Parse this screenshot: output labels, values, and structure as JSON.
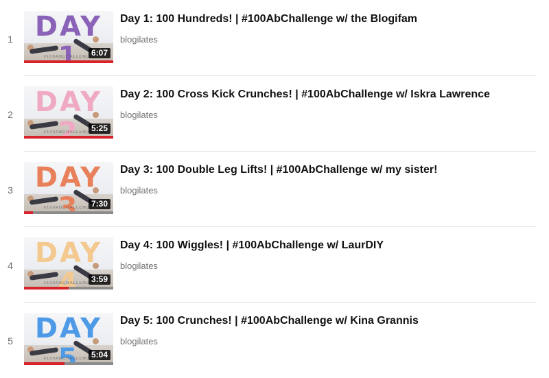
{
  "playlist": {
    "items": [
      {
        "index": "1",
        "day_label": "DAY 1",
        "day_color": "#8a63b8",
        "tagline": "#100ABCHALLENGE",
        "duration": "6:07",
        "title": "Day 1: 100 Hundreds! | #100AbChallenge w/ the Blogifam",
        "channel": "blogilates",
        "watched_progress": 1.0
      },
      {
        "index": "2",
        "day_label": "DAY 2",
        "day_color": "#f0a9c2",
        "tagline": "#100ABCHALLENGE",
        "duration": "5:25",
        "title": "Day 2: 100 Cross Kick Crunches! | #100AbChallenge w/ Iskra Lawrence",
        "channel": "blogilates",
        "watched_progress": 1.0
      },
      {
        "index": "3",
        "day_label": "DAY 3",
        "day_color": "#e8805a",
        "tagline": "#100ABCHALLENGE",
        "duration": "7:30",
        "title": "Day 3: 100 Double Leg Lifts! | #100AbChallenge w/ my sister!",
        "channel": "blogilates",
        "watched_progress": 0.1
      },
      {
        "index": "4",
        "day_label": "DAY 4",
        "day_color": "#f3c98f",
        "tagline": "#100ABCHALLENGE",
        "duration": "3:59",
        "title": "Day 4: 100 Wiggles! | #100AbChallenge w/ LaurDIY",
        "channel": "blogilates",
        "watched_progress": 0.5
      },
      {
        "index": "5",
        "day_label": "DAY 5",
        "day_color": "#4f9ae6",
        "tagline": "#100ABCHALLENGE",
        "duration": "5:04",
        "title": "Day 5: 100 Crunches! | #100AbChallenge w/ Kina Grannis",
        "channel": "blogilates",
        "watched_progress": 0.45
      }
    ]
  }
}
